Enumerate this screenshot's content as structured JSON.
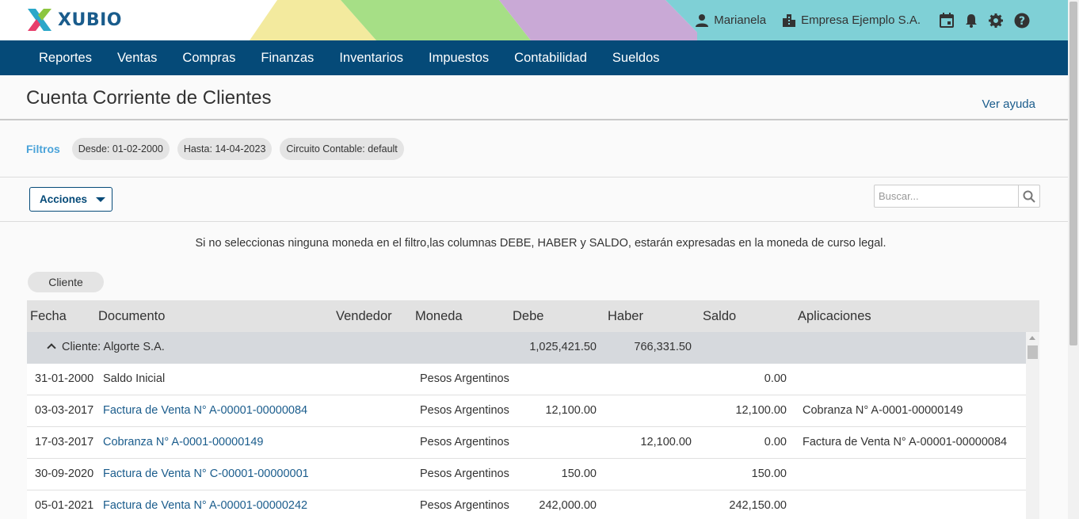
{
  "brand": {
    "name": "XUBIO"
  },
  "header": {
    "user": "Marianela",
    "company": "Empresa Ejemplo S.A.",
    "icons": [
      "user-icon",
      "building-icon",
      "calendar-icon",
      "bell-icon",
      "gear-icon",
      "help-icon"
    ]
  },
  "nav": {
    "items": [
      "Reportes",
      "Ventas",
      "Compras",
      "Finanzas",
      "Inventarios",
      "Impuestos",
      "Contabilidad",
      "Sueldos"
    ]
  },
  "page": {
    "title": "Cuenta Corriente de Clientes",
    "help": "Ver ayuda"
  },
  "filters": {
    "label": "Filtros",
    "chips": [
      {
        "key": "Desde:",
        "value": "01-02-2000"
      },
      {
        "key": "Hasta:",
        "value": "14-04-2023"
      },
      {
        "key": "Circuito Contable:",
        "value": "default"
      }
    ]
  },
  "toolbar": {
    "actions_label": "Acciones",
    "search_placeholder": "Buscar..."
  },
  "notice": "Si no seleccionas ninguna moneda en el filtro,las columnas DEBE, HABER y SALDO, estarán expresadas en la moneda de curso legal.",
  "grouping": {
    "chip": "Cliente"
  },
  "table": {
    "columns": [
      "Fecha",
      "Documento",
      "Vendedor",
      "Moneda",
      "Debe",
      "Haber",
      "Saldo",
      "Aplicaciones"
    ],
    "group": {
      "label": "Cliente: Algorte S.A.",
      "debe": "1,025,421.50",
      "haber": "766,331.50"
    },
    "rows": [
      {
        "fecha": "31-01-2000",
        "documento": "Saldo Inicial",
        "link": false,
        "moneda": "Pesos Argentinos",
        "debe": "",
        "haber": "",
        "saldo": "0.00",
        "aplicaciones": ""
      },
      {
        "fecha": "03-03-2017",
        "documento": "Factura de Venta N° A-00001-00000084",
        "link": true,
        "moneda": "Pesos Argentinos",
        "debe": "12,100.00",
        "haber": "",
        "saldo": "12,100.00",
        "aplicaciones": "Cobranza N° A-0001-00000149"
      },
      {
        "fecha": "17-03-2017",
        "documento": "Cobranza N° A-0001-00000149",
        "link": true,
        "moneda": "Pesos Argentinos",
        "debe": "",
        "haber": "12,100.00",
        "saldo": "0.00",
        "aplicaciones": "Factura de Venta N° A-00001-00000084"
      },
      {
        "fecha": "30-09-2020",
        "documento": "Factura de Venta N° C-00001-00000001",
        "link": true,
        "moneda": "Pesos Argentinos",
        "debe": "150.00",
        "haber": "",
        "saldo": "150.00",
        "aplicaciones": ""
      },
      {
        "fecha": "05-01-2021",
        "documento": "Factura de Venta N° A-00001-00000242",
        "link": true,
        "moneda": "Pesos Argentinos",
        "debe": "242,000.00",
        "haber": "",
        "saldo": "242,150.00",
        "aplicaciones": ""
      }
    ]
  }
}
